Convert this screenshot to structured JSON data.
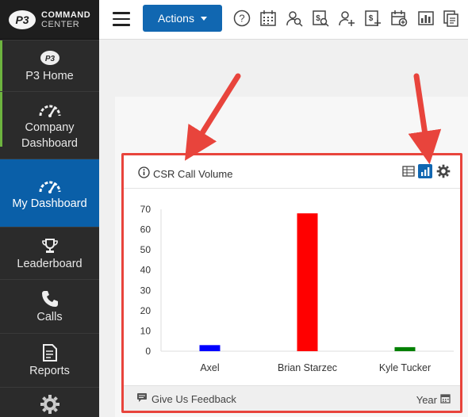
{
  "app": {
    "logo_line1": "COMMAND",
    "logo_line2": "CENTER",
    "logo_mark": "P3"
  },
  "sidebar": {
    "items": [
      {
        "label": "P3 Home",
        "icon": "p3-icon"
      },
      {
        "label": "Company Dashboard",
        "icon": "gauge-icon"
      },
      {
        "label": "My Dashboard",
        "icon": "gauge-icon",
        "active": true
      },
      {
        "label": "Leaderboard",
        "icon": "trophy-icon"
      },
      {
        "label": "Calls",
        "icon": "phone-icon"
      },
      {
        "label": "Reports",
        "icon": "report-icon"
      },
      {
        "label": "",
        "icon": "gear-icon"
      }
    ]
  },
  "toolbar": {
    "actions_label": "Actions",
    "icons": [
      "help-icon",
      "calendar-grid-icon",
      "user-search-icon",
      "dollar-search-icon",
      "add-user-icon",
      "add-dollar-icon",
      "add-calendar-icon",
      "bar-chart-icon",
      "copy-icon"
    ]
  },
  "widget": {
    "title": "CSR Call Volume",
    "feedback_label": "Give Us Feedback",
    "period_label": "Year",
    "active_view": "bar"
  },
  "colors": {
    "sidebar_bg": "#2b2b2b",
    "active_nav": "#0a5fa8",
    "accent": "#6db33f",
    "primary_button": "#1167b1",
    "highlight_border": "#e8443c"
  },
  "chart_data": {
    "type": "bar",
    "title": "CSR Call Volume",
    "categories": [
      "Axel",
      "Brian Starzec",
      "Kyle Tucker"
    ],
    "values": [
      3,
      68,
      2
    ],
    "bar_colors": [
      "#0000ff",
      "#ff0000",
      "#008000"
    ],
    "ylim": [
      0,
      70
    ],
    "yticks": [
      0,
      10,
      20,
      30,
      40,
      50,
      60,
      70
    ],
    "xlabel": "",
    "ylabel": "",
    "grid": false
  }
}
